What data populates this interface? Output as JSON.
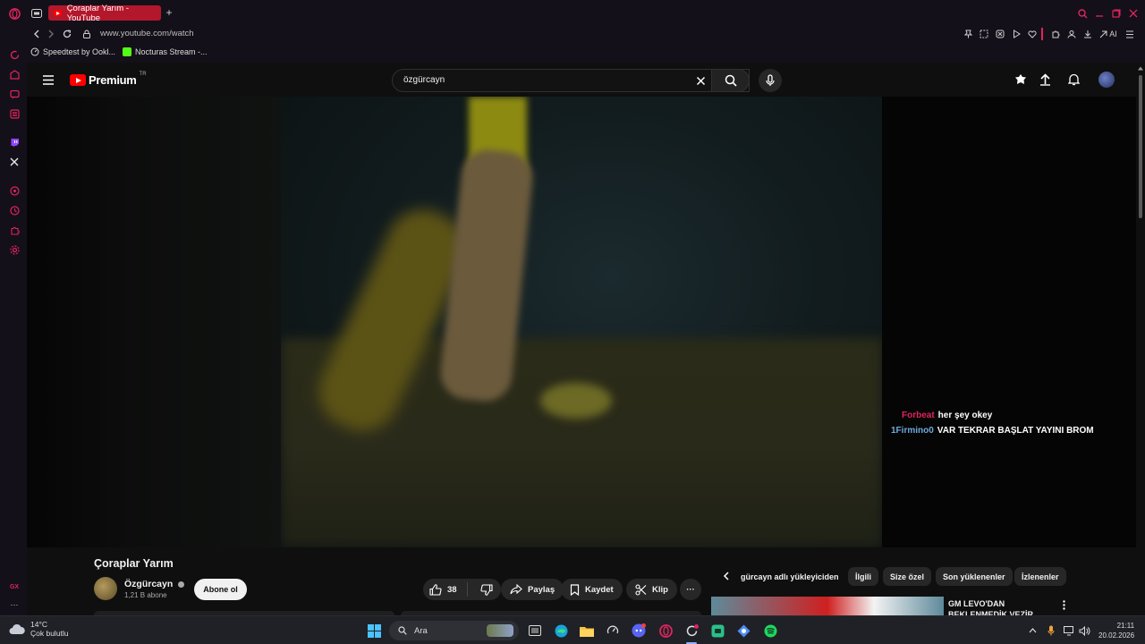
{
  "browser": {
    "tab_title": "Çoraplar Yarım - YouTube",
    "new_tab": "+",
    "url": "www.youtube.com/watch",
    "ai_label": "AI",
    "bookmarks": [
      {
        "label": "Speedtest by Ookl..."
      },
      {
        "label": "Nocturas Stream -..."
      }
    ],
    "sidebar_bottom_label": "GX",
    "sidebar_more": "···"
  },
  "youtube": {
    "logo_text": "Premium",
    "region": "TR",
    "search_value": "özgürcayn"
  },
  "video": {
    "chat": [
      {
        "user": "Forbeat",
        "message": "her şey okey"
      },
      {
        "user": "1Firmino0",
        "message": "VAR TEKRAR BAŞLAT YAYINI BROM"
      }
    ]
  },
  "details": {
    "title": "Çoraplar Yarım",
    "channel": "Özgürcayn",
    "subscribers": "1,21 B abone",
    "subscribe_label": "Abone ol",
    "likes": "38",
    "share_label": "Paylaş",
    "save_label": "Kaydet",
    "clip_label": "Klip",
    "more": "···"
  },
  "recommendations": {
    "chips": [
      "gürcayn adlı yükleyiciden",
      "İlgili",
      "Size özel",
      "Son yüklenenler",
      "İzlenenler"
    ],
    "first_title": "GM LEVO'DAN BEKLENMEDİK VEZİR"
  },
  "taskbar": {
    "temperature": "14°C",
    "weather": "Çok bulutlu",
    "search_placeholder": "Ara",
    "time": "21:11",
    "date": "20.02.2026"
  },
  "colors": {
    "accent": "#e0245e",
    "tab_active": "#b3172c",
    "yt_red": "#ff0000"
  }
}
